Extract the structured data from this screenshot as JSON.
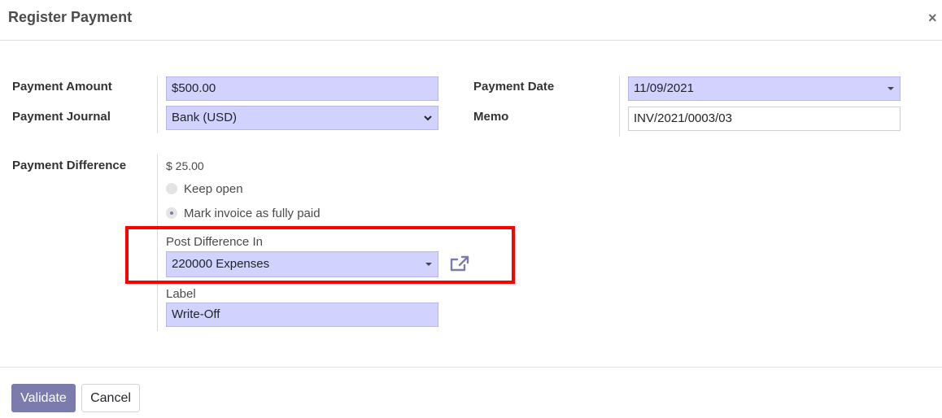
{
  "dialog": {
    "title": "Register Payment",
    "close_symbol": "×"
  },
  "fields": {
    "payment_amount": {
      "label": "Payment Amount",
      "value": "$500.00"
    },
    "payment_journal": {
      "label": "Payment Journal",
      "value": "Bank (USD)"
    },
    "payment_date": {
      "label": "Payment Date",
      "value": "11/09/2021"
    },
    "memo": {
      "label": "Memo",
      "value": "INV/2021/0003/03"
    }
  },
  "payment_difference": {
    "label": "Payment Difference",
    "amount": "$ 25.00",
    "options": [
      {
        "label": "Keep open",
        "selected": false
      },
      {
        "label": "Mark invoice as fully paid",
        "selected": true
      }
    ],
    "post_difference_in": {
      "label": "Post Difference In",
      "value": "220000 Expenses"
    },
    "writeoff_label": {
      "label": "Label",
      "value": "Write-Off"
    }
  },
  "buttons": {
    "validate": "Validate",
    "cancel": "Cancel"
  },
  "colors": {
    "required_field_bg": "#d2d2ff",
    "primary": "#7c7bad",
    "highlight_border": "#ff0000"
  },
  "icons": {
    "close": "close-icon",
    "external_link": "external-link-icon",
    "dropdown": "chevron-down-icon",
    "caret": "caret-down-icon"
  }
}
